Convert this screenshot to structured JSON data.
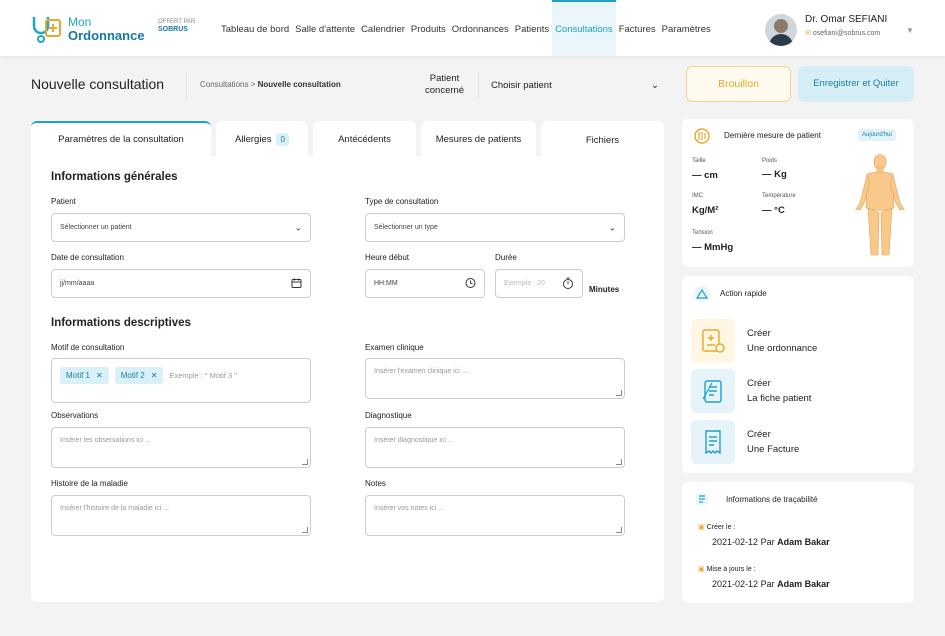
{
  "app": {
    "name_line1": "Mon",
    "name_line2": "Ordonnance",
    "offert": "OFFERT PAR",
    "sponsor": "SOBRUS"
  },
  "nav": [
    {
      "label": "Tableau de bord",
      "active": false
    },
    {
      "label": "Salle d'attente",
      "active": false
    },
    {
      "label": "Calendrier",
      "active": false
    },
    {
      "label": "Produits",
      "active": false
    },
    {
      "label": "Ordonnances",
      "active": false
    },
    {
      "label": "Patients",
      "active": false
    },
    {
      "label": "Consultations",
      "active": true
    },
    {
      "label": "Factures",
      "active": false
    },
    {
      "label": "Paramètres",
      "active": false
    }
  ],
  "user": {
    "name": "Dr. Omar SEFIANI",
    "email": "osefiani@sobrus.com"
  },
  "header": {
    "title": "Nouvelle consultation",
    "crumb_parent": "Consultations",
    "crumb_sep": ">",
    "crumb_current": "Nouvelle consultation",
    "patient_label_1": "Patient",
    "patient_label_2": "concerné",
    "patient_select": "Choisir patient",
    "draft_button": "Brouillon",
    "save_button": "Enregistrer et Quiter"
  },
  "tabs": [
    {
      "label": "Paramètres de la consultation"
    },
    {
      "label": "Allergies",
      "badge": "0"
    },
    {
      "label": "Antécédents"
    },
    {
      "label": "Mesures de patients"
    },
    {
      "label": "Fichiers"
    }
  ],
  "form": {
    "general_title": "Informations générales",
    "patient_label": "Patient",
    "patient_placeholder": "Sélectionner un patient",
    "type_label": "Type de consultation",
    "type_placeholder": "Sélectionner un type",
    "date_label": "Date de consultation",
    "date_placeholder": "jj/mm/aaaa",
    "heure_label": "Heure début",
    "heure_placeholder": "HH:MM",
    "duree_label": "Durée",
    "duree_placeholder": "Exemple : 20",
    "duree_unit": "Minutes",
    "desc_title": "Informations descriptives",
    "motif_label": "Motif de consultation",
    "motif_chips": [
      "Motif 1",
      "Motif 2"
    ],
    "motif_placeholder": "Exemple : \" Motif 3 \"",
    "examen_label": "Examen clinique",
    "examen_placeholder": "Insérer l'examen clinique ici ...",
    "obs_label": "Observations",
    "obs_placeholder": "Insérer les observations ici ...",
    "diag_label": "Diagnostique",
    "diag_placeholder": "Insérer diagnostique ici ...",
    "hist_label": "Histoire de la maladie",
    "hist_placeholder": "Insérer l'histoire de la maladie ici ...",
    "notes_label": "Notes",
    "notes_placeholder": "Insérer vos notes ici ..."
  },
  "measure": {
    "title": "Dernière mesure de patient",
    "badge": "Aujourd'hui",
    "taille_label": "Taille",
    "taille_value": "— cm",
    "poids_label": "Poids",
    "poids_value": "— Kg",
    "imc_label": "IMC",
    "imc_value": "Kg/M²",
    "temp_label": "Température",
    "temp_value": "— °C",
    "tension_label": "Tension",
    "tension_value": "— MmHg"
  },
  "quick": {
    "title": "Action rapide",
    "actions": [
      {
        "l1": "Créer",
        "l2": "Une ordonnance"
      },
      {
        "l1": "Créer",
        "l2": "La fiche patient"
      },
      {
        "l1": "Créer",
        "l2": "Une Facture"
      }
    ]
  },
  "trace": {
    "title": "Informations de traçabilité",
    "created_label": "Créer le :",
    "created_date": "2021-02-12",
    "created_by_word": "Par",
    "created_by": "Adam Bakar",
    "updated_label": "Mise à jours le :",
    "updated_date": "2021-02-12",
    "updated_by_word": "Par",
    "updated_by": "Adam Bakar"
  },
  "colors": {
    "accent": "#1fa1c9",
    "warning": "#e6a92a"
  }
}
